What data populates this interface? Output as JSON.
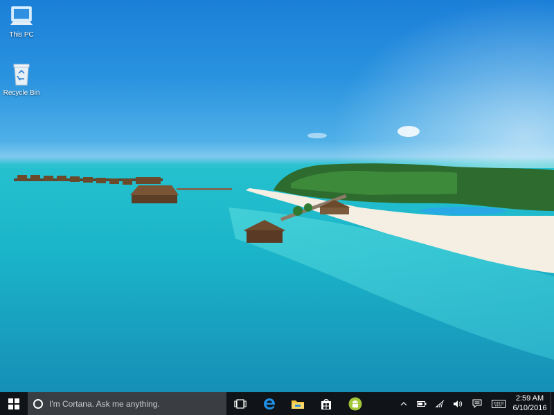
{
  "desktop": {
    "icons": [
      {
        "label": "This PC",
        "icon": "computer-icon"
      },
      {
        "label": "Recycle Bin",
        "icon": "recycle-bin-icon"
      }
    ],
    "wallpaper": "tropical island resort with water villas and turquoise sea"
  },
  "taskbar": {
    "search_placeholder": "I'm Cortana. Ask me anything.",
    "pinned_apps": [
      {
        "name": "task-view",
        "icon": "task-view-icon"
      },
      {
        "name": "edge",
        "icon": "edge-icon"
      },
      {
        "name": "file-explorer",
        "icon": "folder-icon"
      },
      {
        "name": "store",
        "icon": "store-icon"
      },
      {
        "name": "android",
        "icon": "android-icon"
      }
    ],
    "tray": {
      "icons": [
        "chevron-up-icon",
        "battery-icon",
        "wifi-icon",
        "volume-icon",
        "action-center-icon",
        "keyboard-icon"
      ],
      "time": "2:59 AM",
      "date": "6/10/2016"
    },
    "colors": {
      "taskbar_bg": "#101418",
      "search_bg": "#3a3e43",
      "edge_blue": "#1e90e6",
      "android_green": "#a4c639"
    }
  }
}
